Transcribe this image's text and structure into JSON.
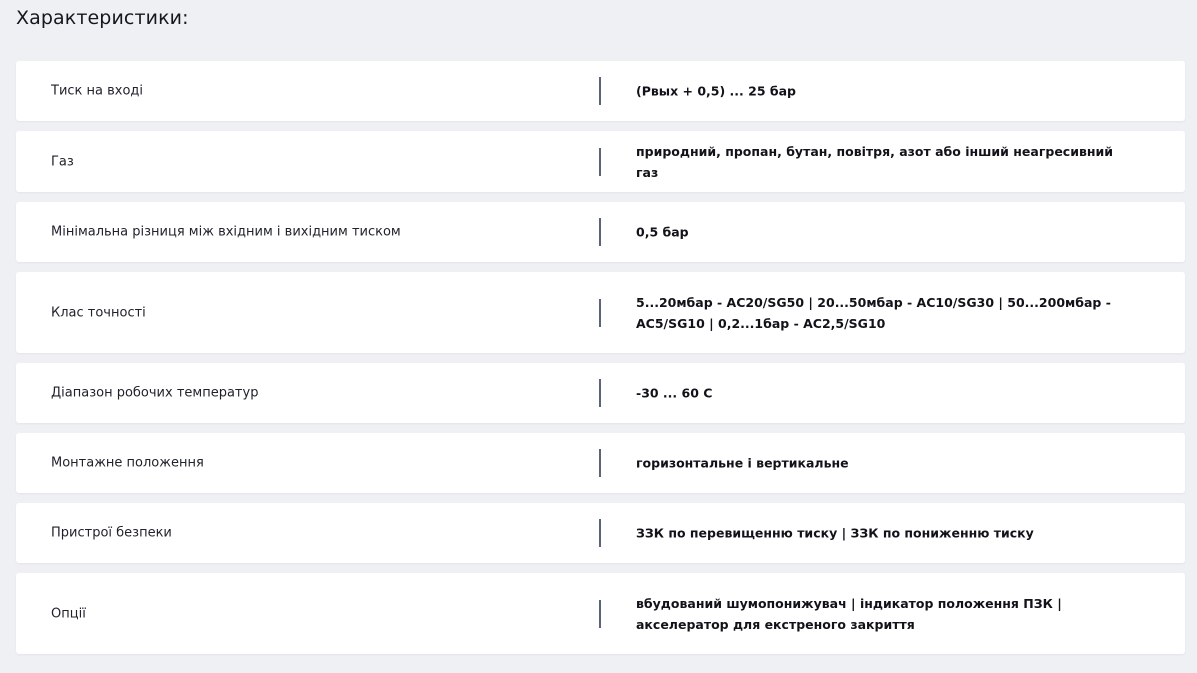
{
  "section": {
    "title": "Характеристики:"
  },
  "specs": [
    {
      "label": "Тиск на вході",
      "value": "(Рвых + 0,5) ... 25 бар"
    },
    {
      "label": "Газ",
      "value": "природний, пропан, бутан, повітря, азот або інший неагресивний газ"
    },
    {
      "label": "Мінімальна різниця між вхідним і вихідним тиском",
      "value": "0,5 бар"
    },
    {
      "label": "Клас точності",
      "value": "5...20мбар - AC20/SG50 | 20...50мбар - AC10/SG30 | 50...200мбар - AC5/SG10 | 0,2...1бар - AC2,5/SG10"
    },
    {
      "label": "Діапазон робочих температур",
      "value": "-30 ... 60 С"
    },
    {
      "label": "Монтажне положення",
      "value": "горизонтальне і вертикальне"
    },
    {
      "label": "Пристрої безпеки",
      "value": "ЗЗК по перевищенню тиску | ЗЗК по пониженню тиску"
    },
    {
      "label": "Опції",
      "value": "вбудований шумопонижувач | індикатор положення ПЗК | акселератор для екстреного закриття"
    }
  ]
}
